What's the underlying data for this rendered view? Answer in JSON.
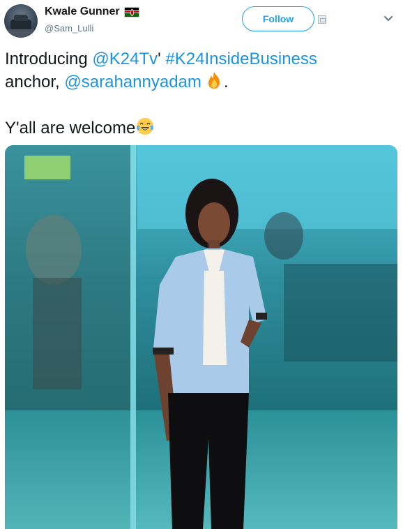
{
  "user": {
    "display_name": "Kwale Gunner",
    "handle": "@Sam_Lulli",
    "flag_icon": "kenya-flag-icon"
  },
  "actions": {
    "follow_label": "Follow"
  },
  "tweet": {
    "line1_prefix": "Introducing ",
    "line1_mention": "@K24Tv",
    "line1_mid": "' ",
    "line1_hashtag": "#K24InsideBusiness",
    "line2_prefix": "anchor, ",
    "line2_mention": "@sarahannyadam",
    "line2_suffix": ".",
    "line3": "Y'all are welcome"
  },
  "colors": {
    "link": "#1b95e0",
    "follow_border": "#1da1f2",
    "handle": "#657786"
  }
}
